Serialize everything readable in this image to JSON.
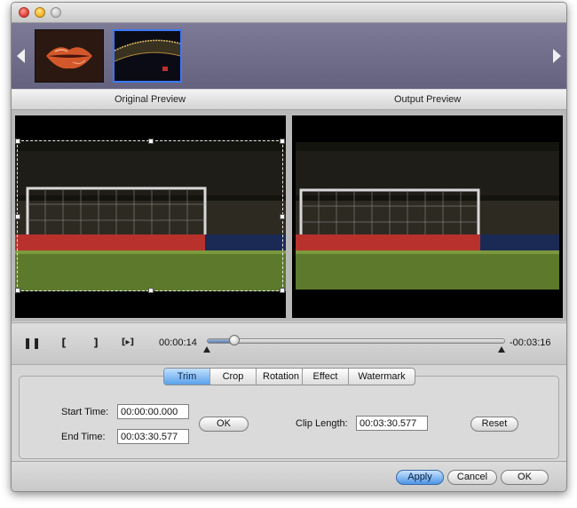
{
  "thumbnails": [
    {
      "name": "lips"
    },
    {
      "name": "stadium"
    }
  ],
  "preview": {
    "original_label": "Original Preview",
    "output_label": "Output Preview"
  },
  "playback": {
    "current_time": "00:00:14",
    "remaining_time": "-00:03:16",
    "progress": 0.09,
    "controls": {
      "pause_icon": "pause-icon",
      "mark_in_icon": "bracket-left-icon",
      "mark_out_icon": "bracket-right-icon",
      "next_frame_icon": "step-frame-icon"
    }
  },
  "tabs": [
    {
      "label": "Trim",
      "active": true
    },
    {
      "label": "Crop",
      "active": false
    },
    {
      "label": "Rotation",
      "active": false
    },
    {
      "label": "Effect",
      "active": false
    },
    {
      "label": "Watermark",
      "active": false
    }
  ],
  "trim": {
    "start_time_label": "Start Time:",
    "start_time_value": "00:00:00.000",
    "end_time_label": "End Time:",
    "end_time_value": "00:03:30.577",
    "ok_label": "OK",
    "clip_length_label": "Clip Length:",
    "clip_length_value": "00:03:30.577",
    "reset_label": "Reset"
  },
  "footer": {
    "apply_label": "Apply",
    "cancel_label": "Cancel",
    "ok_label": "OK"
  },
  "colors": {
    "accent": "#5aa0ea",
    "strip_bg": "#6e6c88",
    "selected_thumb_border": "#3b78ff"
  }
}
